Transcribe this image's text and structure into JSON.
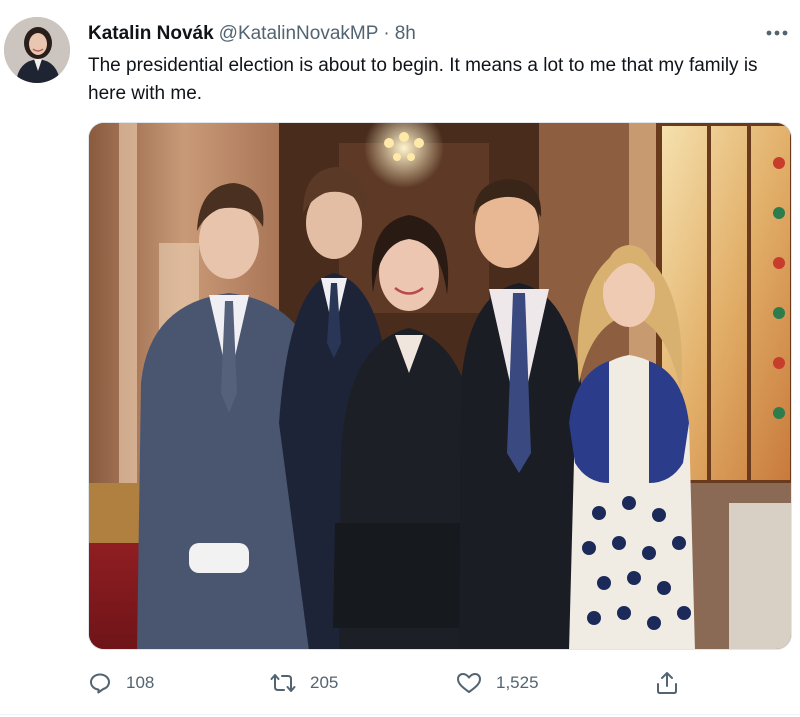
{
  "author": {
    "display_name": "Katalin Novák",
    "handle": "@KatalinNovakMP",
    "separator": "·",
    "time": "8h"
  },
  "tweet": {
    "text": "The presidential election is about to begin. It means a lot to me that my family is here with me."
  },
  "media": {
    "type": "photo"
  },
  "actions": {
    "reply_count": "108",
    "retweet_count": "205",
    "like_count": "1,525",
    "share_count": ""
  },
  "icons": {
    "more": "more-horizontal-icon",
    "reply": "reply-icon",
    "retweet": "retweet-icon",
    "like": "heart-icon",
    "share": "share-icon"
  },
  "colors": {
    "secondary_text": "#536471",
    "primary_text": "#0f1419"
  }
}
